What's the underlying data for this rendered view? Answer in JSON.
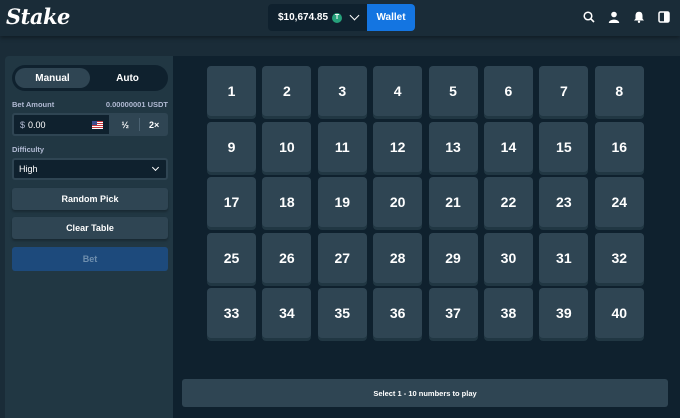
{
  "header": {
    "logo": "Stake",
    "balance": "$10,674.85",
    "currency_badge": "T",
    "wallet_label": "Wallet",
    "icons": [
      "search-icon",
      "user-icon",
      "bell-icon",
      "sidebar-toggle-icon"
    ]
  },
  "sidebar": {
    "mode_tabs": [
      {
        "label": "Manual",
        "active": true
      },
      {
        "label": "Auto",
        "active": false
      }
    ],
    "bet_amount": {
      "label": "Bet Amount",
      "conversion": "0.00000001 USDT",
      "currency_symbol": "$",
      "value": "0.00",
      "half_label": "½",
      "double_label": "2×"
    },
    "difficulty": {
      "label": "Difficulty",
      "selected": "High"
    },
    "random_pick_label": "Random Pick",
    "clear_table_label": "Clear Table",
    "bet_label": "Bet"
  },
  "board": {
    "numbers": [
      "1",
      "2",
      "3",
      "4",
      "5",
      "6",
      "7",
      "8",
      "9",
      "10",
      "11",
      "12",
      "13",
      "14",
      "15",
      "16",
      "17",
      "18",
      "19",
      "20",
      "21",
      "22",
      "23",
      "24",
      "25",
      "26",
      "27",
      "28",
      "29",
      "30",
      "31",
      "32",
      "33",
      "34",
      "35",
      "36",
      "37",
      "38",
      "39",
      "40"
    ],
    "status": "Select 1 - 10 numbers to play"
  },
  "colors": {
    "background": "#1a2c38",
    "sidebar": "#213743",
    "board": "#0f212e",
    "tile": "#2f4553",
    "wallet_button": "#1475e1",
    "bet_button": "#1d4a7c"
  }
}
